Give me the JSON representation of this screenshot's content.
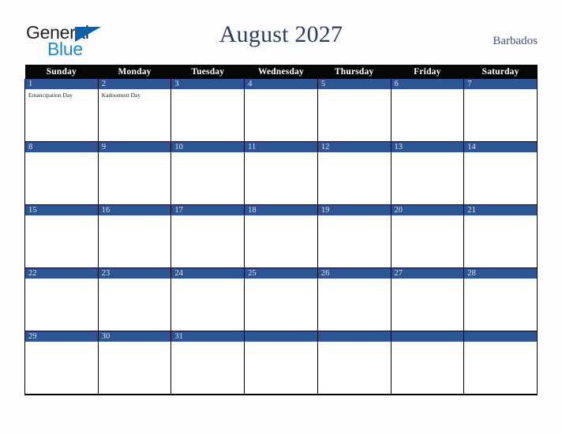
{
  "brand": {
    "name_part1": "General",
    "name_part2": "Blue",
    "triangle_icon": "triangle-icon"
  },
  "header": {
    "title": "August 2027",
    "region": "Barbados",
    "colors": {
      "title": "#2c3c64",
      "region": "#3c5585",
      "date_strip": "#2f5496",
      "weekday_header_bg": "#060606",
      "page_bg": "#fdfdfd",
      "logo_general": "#231f20",
      "logo_blue": "#1b8ad6",
      "logo_triangle": "#1060a8"
    }
  },
  "calendar": {
    "month": "August",
    "year": "2027",
    "weekdays": [
      "Sunday",
      "Monday",
      "Tuesday",
      "Wednesday",
      "Thursday",
      "Friday",
      "Saturday"
    ],
    "weeks": [
      {
        "days": [
          {
            "number": "1",
            "events": [
              "Emancipation Day"
            ]
          },
          {
            "number": "2",
            "events": [
              "Kadooment Day"
            ]
          },
          {
            "number": "3",
            "events": []
          },
          {
            "number": "4",
            "events": []
          },
          {
            "number": "5",
            "events": []
          },
          {
            "number": "6",
            "events": []
          },
          {
            "number": "7",
            "events": []
          }
        ]
      },
      {
        "days": [
          {
            "number": "8",
            "events": []
          },
          {
            "number": "9",
            "events": []
          },
          {
            "number": "10",
            "events": []
          },
          {
            "number": "11",
            "events": []
          },
          {
            "number": "12",
            "events": []
          },
          {
            "number": "13",
            "events": []
          },
          {
            "number": "14",
            "events": []
          }
        ]
      },
      {
        "days": [
          {
            "number": "15",
            "events": []
          },
          {
            "number": "16",
            "events": []
          },
          {
            "number": "17",
            "events": []
          },
          {
            "number": "18",
            "events": []
          },
          {
            "number": "19",
            "events": []
          },
          {
            "number": "20",
            "events": []
          },
          {
            "number": "21",
            "events": []
          }
        ]
      },
      {
        "days": [
          {
            "number": "22",
            "events": []
          },
          {
            "number": "23",
            "events": []
          },
          {
            "number": "24",
            "events": []
          },
          {
            "number": "25",
            "events": []
          },
          {
            "number": "26",
            "events": []
          },
          {
            "number": "27",
            "events": []
          },
          {
            "number": "28",
            "events": []
          }
        ]
      },
      {
        "days": [
          {
            "number": "29",
            "events": []
          },
          {
            "number": "30",
            "events": []
          },
          {
            "number": "31",
            "events": []
          },
          {
            "number": "",
            "events": []
          },
          {
            "number": "",
            "events": []
          },
          {
            "number": "",
            "events": []
          },
          {
            "number": "",
            "events": []
          }
        ]
      }
    ]
  }
}
